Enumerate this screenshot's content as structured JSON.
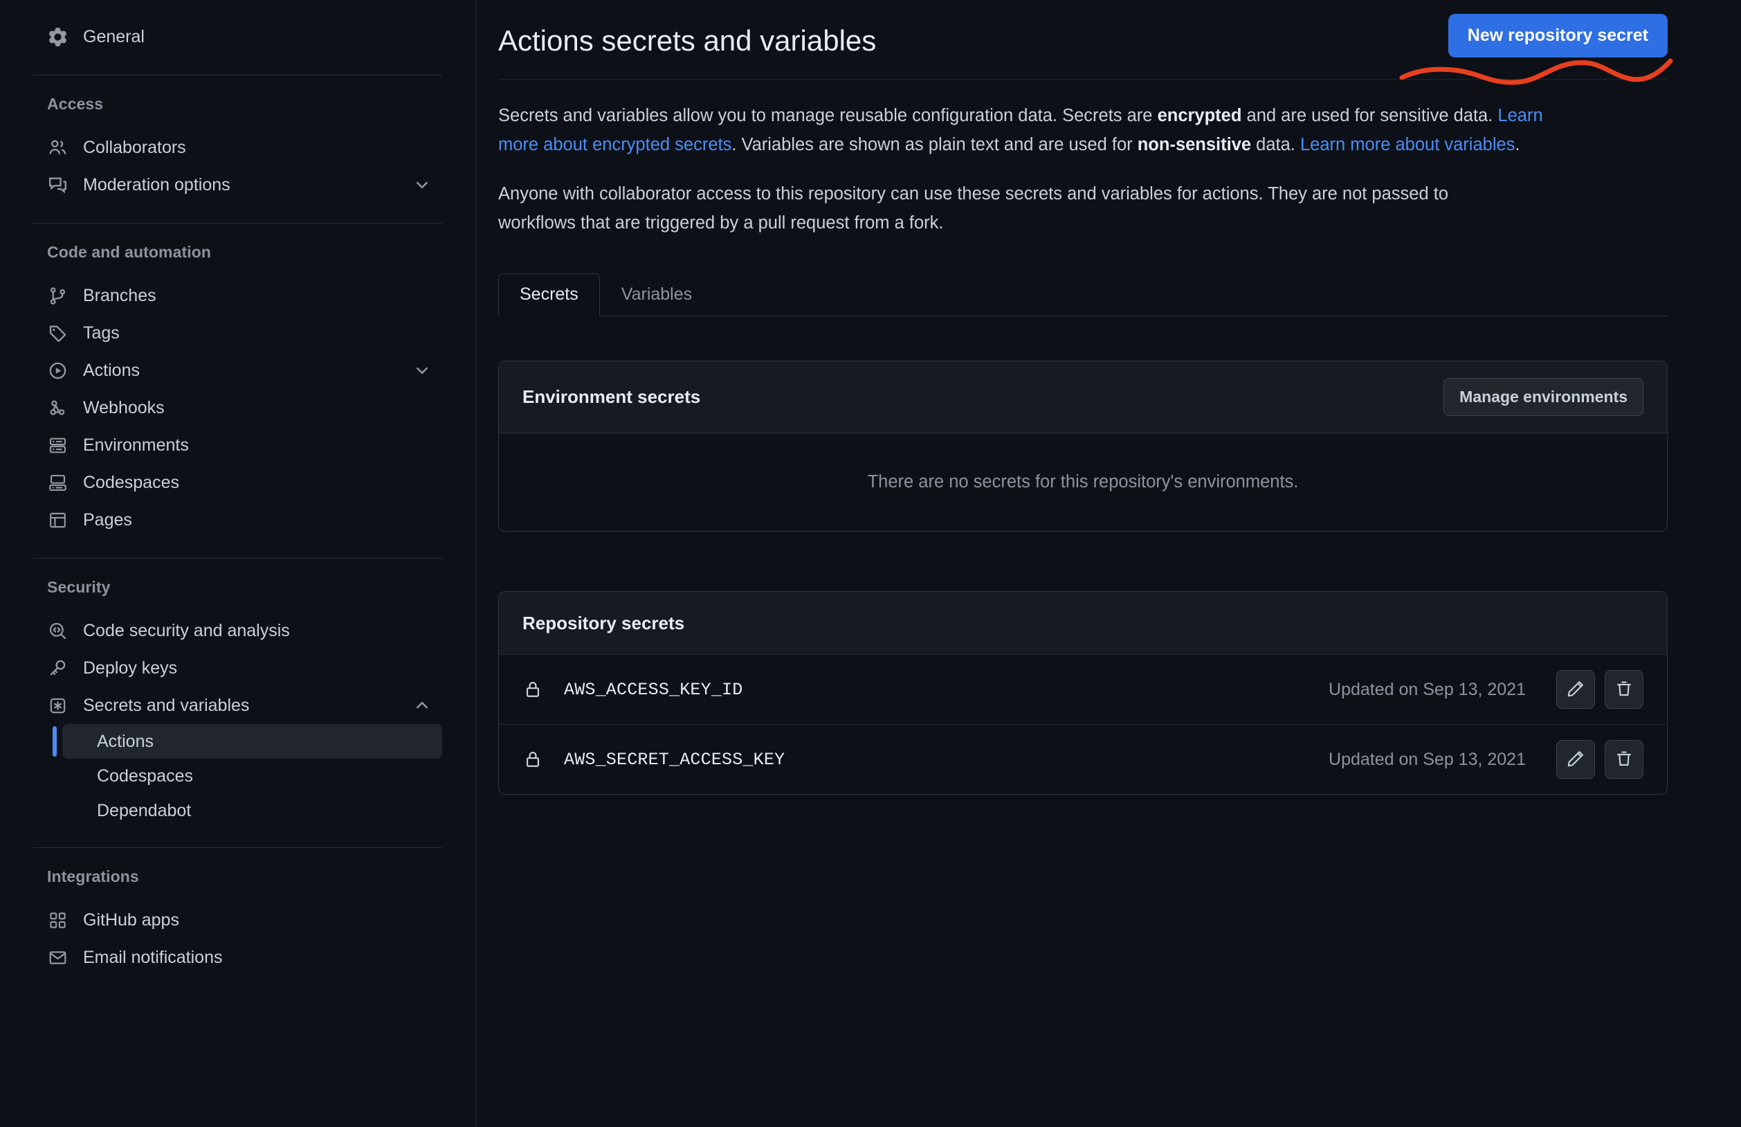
{
  "colors": {
    "background": "#0d1117",
    "accent": "#2f6fe4",
    "link": "#4a8df8",
    "annotation": "#e8401f",
    "active_indicator": "#4c8bf5",
    "card_header": "#161b22",
    "border": "#30363d"
  },
  "sidebar": {
    "top_items": [
      {
        "label": "General",
        "icon": "gear-icon",
        "name": "general"
      }
    ],
    "sections": [
      {
        "title": "Access",
        "name": "access",
        "items": [
          {
            "label": "Collaborators",
            "icon": "people-icon",
            "name": "collaborators",
            "chevron": ""
          },
          {
            "label": "Moderation options",
            "icon": "comment-discussion-icon",
            "name": "moderation-options",
            "chevron": "down"
          }
        ]
      },
      {
        "title": "Code and automation",
        "name": "code-and-automation",
        "items": [
          {
            "label": "Branches",
            "icon": "git-branch-icon",
            "name": "branches",
            "chevron": ""
          },
          {
            "label": "Tags",
            "icon": "tag-icon",
            "name": "tags",
            "chevron": ""
          },
          {
            "label": "Actions",
            "icon": "play-circle-icon",
            "name": "actions",
            "chevron": "down"
          },
          {
            "label": "Webhooks",
            "icon": "webhook-icon",
            "name": "webhooks",
            "chevron": ""
          },
          {
            "label": "Environments",
            "icon": "server-icon",
            "name": "environments",
            "chevron": ""
          },
          {
            "label": "Codespaces",
            "icon": "codespaces-icon",
            "name": "codespaces",
            "chevron": ""
          },
          {
            "label": "Pages",
            "icon": "browser-icon",
            "name": "pages",
            "chevron": ""
          }
        ]
      },
      {
        "title": "Security",
        "name": "security",
        "items": [
          {
            "label": "Code security and analysis",
            "icon": "code-scan-icon",
            "name": "code-security-and-analysis",
            "chevron": ""
          },
          {
            "label": "Deploy keys",
            "icon": "key-icon",
            "name": "deploy-keys",
            "chevron": ""
          },
          {
            "label": "Secrets and variables",
            "icon": "asterisk-key-icon",
            "name": "secrets-and-variables",
            "chevron": "up"
          }
        ],
        "sub_items": [
          {
            "label": "Actions",
            "name": "secrets-actions",
            "active": true
          },
          {
            "label": "Codespaces",
            "name": "secrets-codespaces",
            "active": false
          },
          {
            "label": "Dependabot",
            "name": "secrets-dependabot",
            "active": false
          }
        ]
      },
      {
        "title": "Integrations",
        "name": "integrations",
        "items": [
          {
            "label": "GitHub apps",
            "icon": "apps-grid-icon",
            "name": "github-apps",
            "chevron": ""
          },
          {
            "label": "Email notifications",
            "icon": "mail-icon",
            "name": "email-notifications",
            "chevron": ""
          }
        ]
      }
    ]
  },
  "header": {
    "title": "Actions secrets and variables",
    "new_secret_button": "New repository secret"
  },
  "description": {
    "p1_part1": "Secrets and variables allow you to manage reusable configuration data. Secrets are ",
    "p1_bold1": "encrypted",
    "p1_part2": " and are used for sensitive data. ",
    "p1_link1": "Learn more about encrypted secrets",
    "p1_part3": ". Variables are shown as plain text and are used for ",
    "p1_bold2": "non-sensitive",
    "p1_part4": " data. ",
    "p1_link2": "Learn more about variables",
    "p1_part5": ".",
    "p2": "Anyone with collaborator access to this repository can use these secrets and variables for actions. They are not passed to workflows that are triggered by a pull request from a fork."
  },
  "tabs": [
    {
      "label": "Secrets",
      "name": "tab-secrets",
      "active": true
    },
    {
      "label": "Variables",
      "name": "tab-variables",
      "active": false
    }
  ],
  "environment_secrets": {
    "title": "Environment secrets",
    "manage_button": "Manage environments",
    "empty_message": "There are no secrets for this repository's environments."
  },
  "repository_secrets": {
    "title": "Repository secrets",
    "rows": [
      {
        "name": "AWS_ACCESS_KEY_ID",
        "updated": "Updated on Sep 13, 2021"
      },
      {
        "name": "AWS_SECRET_ACCESS_KEY",
        "updated": "Updated on Sep 13, 2021"
      }
    ]
  }
}
